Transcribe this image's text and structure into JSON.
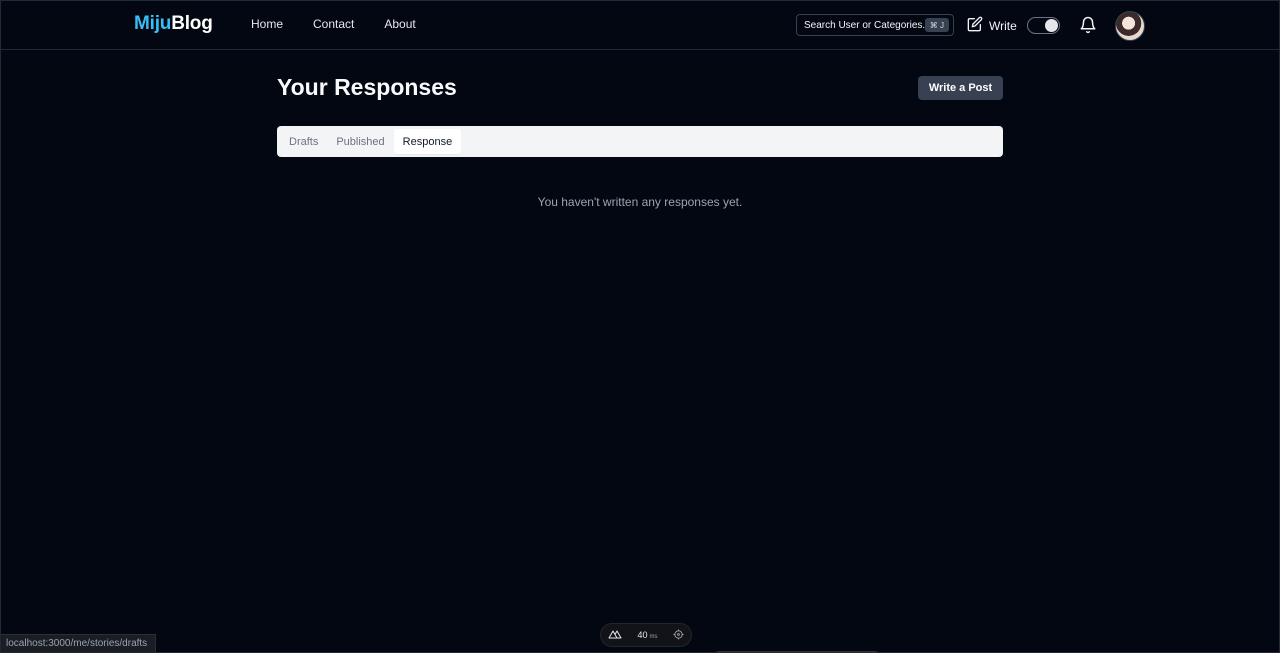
{
  "header": {
    "logo": {
      "part1": "Miju",
      "part2": "Blog"
    },
    "nav": [
      "Home",
      "Contact",
      "About"
    ],
    "search": {
      "placeholder": "Search User or Categories...",
      "shortcut": "⌘ J"
    },
    "write_label": "Write"
  },
  "main": {
    "title": "Your Responses",
    "write_post_button": "Write a Post",
    "tabs": [
      {
        "label": "Drafts",
        "active": false
      },
      {
        "label": "Published",
        "active": false
      },
      {
        "label": "Response",
        "active": true
      }
    ],
    "empty_message": "You haven't written any responses yet."
  },
  "status_bar": {
    "url": "localhost:3000/me/stories/drafts"
  },
  "devbar": {
    "value": "40",
    "unit": "ms"
  },
  "colors": {
    "accent": "#38bdf8",
    "background": "#030712",
    "button": "#374151"
  }
}
